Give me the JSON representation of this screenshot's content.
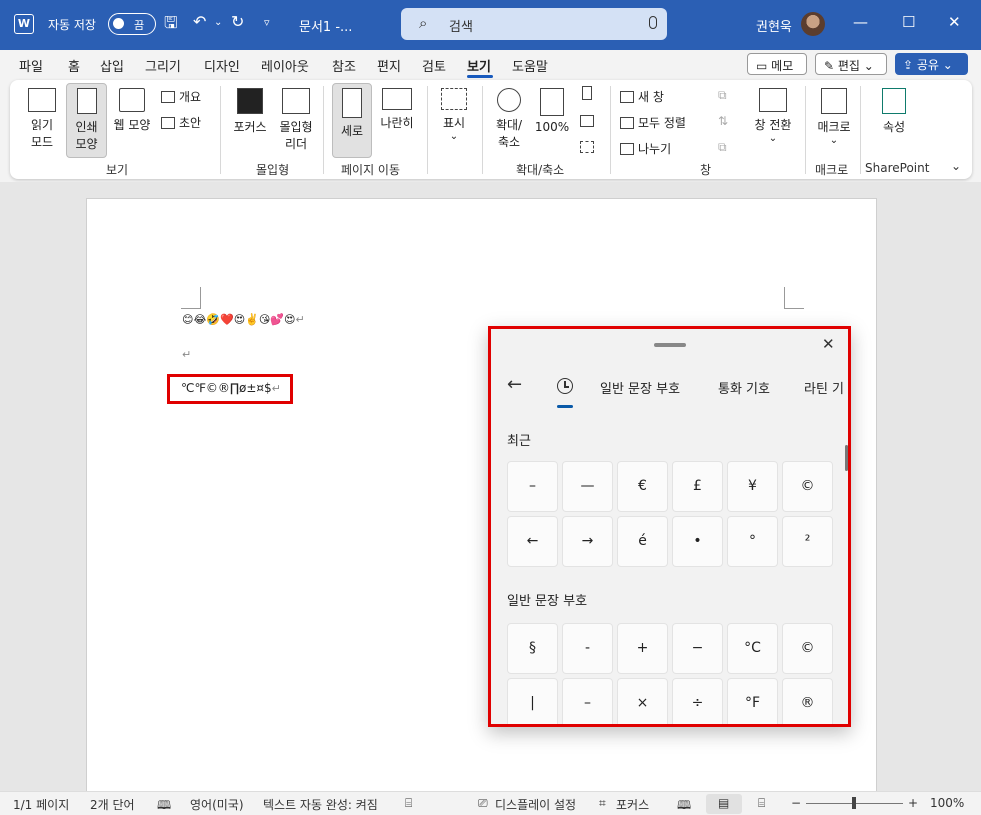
{
  "titlebar": {
    "app_icon": "W",
    "autosave_label": "자동 저장",
    "autosave_state": "끔",
    "doc_title": "문서1  -...",
    "search_placeholder": "검색",
    "user_name": "권현욱",
    "icons": [
      "word-icon",
      "save-icon",
      "undo-icon",
      "redo-icon",
      "customize-icon",
      "search-icon",
      "mic-icon",
      "minimize-icon",
      "maximize-icon",
      "close-icon"
    ]
  },
  "menu": {
    "items": [
      "파일",
      "홈",
      "삽입",
      "그리기",
      "디자인",
      "레이아웃",
      "참조",
      "편지",
      "검토",
      "보기",
      "도움말"
    ],
    "active": "보기",
    "memo_label": "메모",
    "edit_label": "편집",
    "share_label": "공유"
  },
  "ribbon": {
    "reading_mode": "읽기\n모드",
    "print_layout": "인쇄\n모양",
    "web_layout": "웹 모양",
    "outline": "개요",
    "draft": "초안",
    "group_view": "보기",
    "focus": "포커스",
    "immersive_reader": "몰입형\n리더",
    "group_immersive": "몰입형",
    "vertical": "세로",
    "side_by_side": "나란히",
    "group_page_movement": "페이지 이동",
    "show": "표시",
    "zoom": "확대/\n축소",
    "zoom_100": "100%",
    "group_zoom": "확대/축소",
    "new_window": "새 창",
    "arrange_all": "모두 정렬",
    "split": "나누기",
    "switch_window": "창 전환",
    "group_window": "창",
    "macros": "매크로",
    "group_macros": "매크로",
    "properties": "속성",
    "group_sharepoint": "SharePoint"
  },
  "document": {
    "emoji_line": "😊😂🤣❤️😍✌️😘💕😍",
    "empty_line": "",
    "symbol_line": "℃℉©®∏ø±¤$",
    "pilcrow": "↵"
  },
  "emoji_panel": {
    "tabs": [
      "일반 문장 부호",
      "통화 기호",
      "라틴 기"
    ],
    "recent_label": "최근",
    "recent": [
      "–",
      "—",
      "€",
      "£",
      "¥",
      "©",
      "←",
      "→",
      "é",
      "•",
      "°",
      "²"
    ],
    "punct_label": "일반 문장 부호",
    "punct": [
      "§",
      "-",
      "+",
      "−",
      "°C",
      "©",
      "|",
      "–",
      "×",
      "÷",
      "°F",
      "®"
    ]
  },
  "statusbar": {
    "page": "1/1 페이지",
    "words": "2개 단어",
    "language": "영어(미국)",
    "autocomplete": "텍스트 자동 완성: 켜짐",
    "display_settings": "디스플레이 설정",
    "focus": "포커스",
    "zoom_level": "100%",
    "zoom_minus": "−",
    "zoom_plus": "+"
  }
}
